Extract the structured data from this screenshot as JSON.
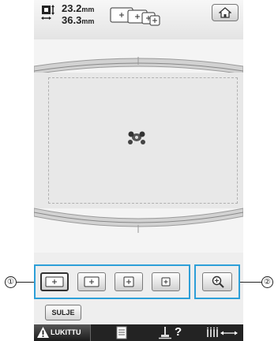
{
  "header": {
    "width_value": "23.2",
    "height_value": "36.3",
    "unit": "mm"
  },
  "icons": {
    "size": "size-icon",
    "hoop": "hoop-sizes-icon",
    "home": "home-icon",
    "pattern": "embroidery-pattern-icon",
    "zoom": "zoom-in-icon",
    "lock": "warning-lock-icon",
    "page": "page-icon",
    "help": "help-icon",
    "density": "thread-density-icon"
  },
  "preview_buttons": [
    {
      "icon": "hoop-size-largest-icon",
      "selected": true
    },
    {
      "icon": "hoop-size-large-icon",
      "selected": false
    },
    {
      "icon": "hoop-size-medium-icon",
      "selected": false
    },
    {
      "icon": "hoop-size-small-icon",
      "selected": false
    }
  ],
  "close_label": "SULJE",
  "bottom_bar": {
    "lock_label": "LUKITTU",
    "help_label": "?"
  },
  "callouts": [
    "①",
    "②"
  ],
  "colors": {
    "highlight_border": "#2d9fd8",
    "bottom_bar": "#232323",
    "screen_bg": "#eeeeee"
  }
}
